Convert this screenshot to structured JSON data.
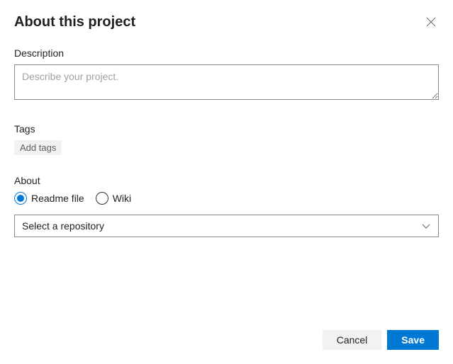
{
  "header": {
    "title": "About this project"
  },
  "description": {
    "label": "Description",
    "placeholder": "Describe your project.",
    "value": ""
  },
  "tags": {
    "label": "Tags",
    "add_label": "Add tags"
  },
  "about": {
    "label": "About",
    "options": {
      "readme": "Readme file",
      "wiki": "Wiki"
    },
    "selected": "readme",
    "dropdown_placeholder": "Select a repository"
  },
  "footer": {
    "cancel_label": "Cancel",
    "save_label": "Save"
  }
}
